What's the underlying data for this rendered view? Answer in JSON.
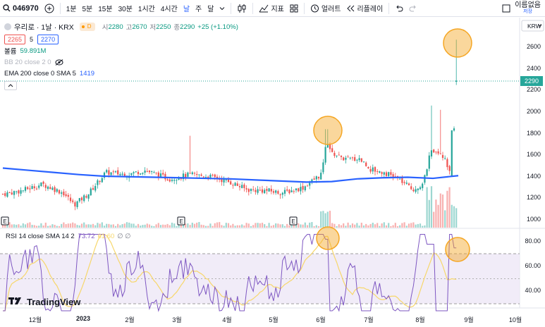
{
  "toolbar": {
    "symbol": "046970",
    "intervals": [
      "1분",
      "5분",
      "15분",
      "30분",
      "1시간",
      "4시간",
      "날",
      "주",
      "달"
    ],
    "active_interval": "날",
    "indicators_label": "지표",
    "alert_label": "얼러트",
    "replay_label": "리플레이",
    "layout_name": "이름없음",
    "layout_sub": "저장"
  },
  "legend": {
    "name": "우리로 · 1날 · KRX",
    "badge": "D",
    "open_label": "시",
    "open": "2280",
    "high_label": "고",
    "high": "2670",
    "low_label": "저",
    "low": "2250",
    "close_label": "종",
    "close": "2290",
    "change": "+25 (+1.10%)",
    "bid": "2265",
    "qty": "5",
    "ask": "2270",
    "volume_label": "볼륨",
    "volume": "59.891M",
    "bb_label": "BB 20 close 2 0",
    "ema_label": "EMA 200 close 0 SMA 5",
    "ema_value": "1419",
    "rsi_label": "RSI 14 close SMA 14 2",
    "rsi_value": "73.72",
    "rsi_sma": "61.60",
    "rsi_extra": "∅ ∅"
  },
  "currency": "KRW",
  "last_price_label": "2290",
  "watermark": "TradingView",
  "earnings_marker": "E",
  "colors": {
    "up": "#26a69a",
    "down": "#ef5350",
    "ema": "#2962ff",
    "rsi": "#7e57c2",
    "rsi_ma": "#f7d76b",
    "highlight": "#f5a623"
  },
  "chart_data": {
    "type": "candlestick",
    "price_axis": {
      "ticks": [
        1000,
        1200,
        1400,
        1600,
        1800,
        2000,
        2200,
        2400,
        2600
      ],
      "range": [
        950,
        2750
      ]
    },
    "rsi_axis": {
      "ticks": [
        40,
        60,
        80
      ],
      "range": [
        20,
        90
      ],
      "levels": [
        30,
        50,
        70
      ]
    },
    "x_ticks": [
      "12월",
      "2023",
      "2월",
      "3월",
      "4월",
      "5월",
      "6월",
      "7월",
      "8월",
      "9월",
      "10월"
    ],
    "ema200": [
      1480,
      1460,
      1440,
      1420,
      1405,
      1400,
      1395,
      1390,
      1385,
      1380,
      1370,
      1360,
      1350,
      1355,
      1380,
      1390,
      1395,
      1385,
      1410
    ],
    "last_close": 2290,
    "highlights": [
      "spike-2023-06",
      "spike-2023-09-price",
      "rsi-peak-2023-06",
      "rsi-peak-2023-09"
    ]
  }
}
